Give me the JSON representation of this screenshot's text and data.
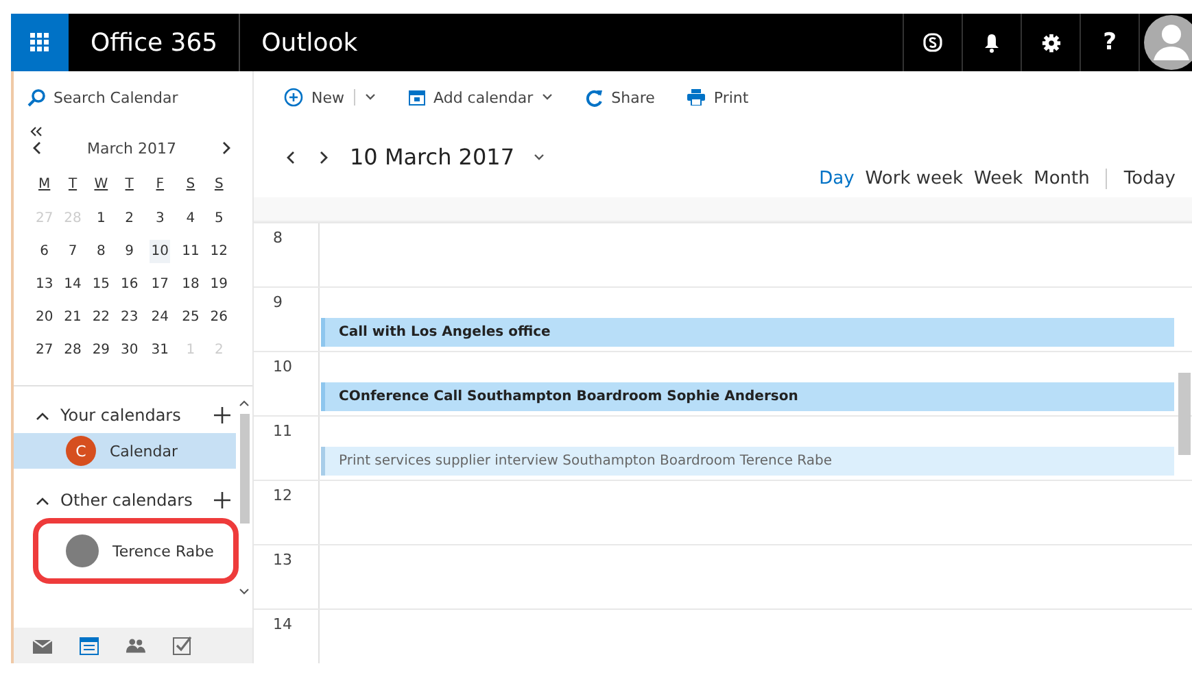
{
  "header": {
    "brand": "Office 365",
    "app": "Outlook",
    "actions": [
      {
        "kind": "skype"
      },
      {
        "kind": "bell"
      },
      {
        "kind": "gear"
      },
      {
        "kind": "help",
        "label": "?"
      }
    ]
  },
  "search": {
    "placeholder": "Search Calendar"
  },
  "toolbar": [
    {
      "kind": "new",
      "label": "New",
      "menu": true
    },
    {
      "kind": "add",
      "label": "Add calendar",
      "menu": true
    },
    {
      "kind": "share",
      "label": "Share",
      "menu": false
    },
    {
      "kind": "print",
      "label": "Print",
      "menu": false
    }
  ],
  "mini_calendar": {
    "month": "March 2017",
    "weekdays": [
      "M",
      "T",
      "W",
      "T",
      "F",
      "S",
      "S"
    ],
    "weeks": [
      [
        {
          "day": "27",
          "outside": true,
          "selected": false
        },
        {
          "day": "28",
          "outside": true,
          "selected": false
        },
        {
          "day": "1",
          "outside": false,
          "selected": false
        },
        {
          "day": "2",
          "outside": false,
          "selected": false
        },
        {
          "day": "3",
          "outside": false,
          "selected": false
        },
        {
          "day": "4",
          "outside": false,
          "selected": false
        },
        {
          "day": "5",
          "outside": false,
          "selected": false
        }
      ],
      [
        {
          "day": "6",
          "outside": false,
          "selected": false
        },
        {
          "day": "7",
          "outside": false,
          "selected": false
        },
        {
          "day": "8",
          "outside": false,
          "selected": false
        },
        {
          "day": "9",
          "outside": false,
          "selected": false
        },
        {
          "day": "10",
          "outside": false,
          "selected": true
        },
        {
          "day": "11",
          "outside": false,
          "selected": false
        },
        {
          "day": "12",
          "outside": false,
          "selected": false
        }
      ],
      [
        {
          "day": "13",
          "outside": false,
          "selected": false
        },
        {
          "day": "14",
          "outside": false,
          "selected": false
        },
        {
          "day": "15",
          "outside": false,
          "selected": false
        },
        {
          "day": "16",
          "outside": false,
          "selected": false
        },
        {
          "day": "17",
          "outside": false,
          "selected": false
        },
        {
          "day": "18",
          "outside": false,
          "selected": false
        },
        {
          "day": "19",
          "outside": false,
          "selected": false
        }
      ],
      [
        {
          "day": "20",
          "outside": false,
          "selected": false
        },
        {
          "day": "21",
          "outside": false,
          "selected": false
        },
        {
          "day": "22",
          "outside": false,
          "selected": false
        },
        {
          "day": "23",
          "outside": false,
          "selected": false
        },
        {
          "day": "24",
          "outside": false,
          "selected": false
        },
        {
          "day": "25",
          "outside": false,
          "selected": false
        },
        {
          "day": "26",
          "outside": false,
          "selected": false
        }
      ],
      [
        {
          "day": "27",
          "outside": false,
          "selected": false
        },
        {
          "day": "28",
          "outside": false,
          "selected": false
        },
        {
          "day": "29",
          "outside": false,
          "selected": false
        },
        {
          "day": "30",
          "outside": false,
          "selected": false
        },
        {
          "day": "31",
          "outside": false,
          "selected": false
        },
        {
          "day": "1",
          "outside": true,
          "selected": false
        },
        {
          "day": "2",
          "outside": true,
          "selected": false
        }
      ]
    ]
  },
  "calendar_groups": [
    {
      "title": "Your calendars",
      "items": [
        {
          "name": "Calendar",
          "initial": "C",
          "color": "#d64f1f",
          "kind": "initial",
          "selected": true,
          "highlighted": false
        }
      ]
    },
    {
      "title": "Other calendars",
      "items": [
        {
          "name": "Terence Rabe",
          "kind": "photo",
          "selected": false,
          "highlighted": true
        }
      ]
    }
  ],
  "bottom_nav": [
    {
      "kind": "mail",
      "selected": false
    },
    {
      "kind": "calendar",
      "selected": true
    },
    {
      "kind": "people",
      "selected": false
    },
    {
      "kind": "tasks",
      "selected": false
    }
  ],
  "date_title": "10 March 2017",
  "views": [
    {
      "label": "Day",
      "selected": true
    },
    {
      "label": "Work week",
      "selected": false
    },
    {
      "label": "Week",
      "selected": false
    },
    {
      "label": "Month",
      "selected": false
    }
  ],
  "today": "Today",
  "hours": [
    {
      "label": "8"
    },
    {
      "label": "9",
      "events": [
        {
          "title": "Call with Los Angeles office",
          "tentative": false
        }
      ]
    },
    {
      "label": "10",
      "events": [
        {
          "title": "COnference Call Southampton Boardroom Sophie Anderson",
          "tentative": false
        }
      ]
    },
    {
      "label": "11",
      "events": [
        {
          "title": "Print services supplier interview Southampton Boardroom Terence Rabe",
          "tentative": true
        }
      ]
    },
    {
      "label": "12"
    },
    {
      "label": "13"
    },
    {
      "label": "14"
    }
  ]
}
